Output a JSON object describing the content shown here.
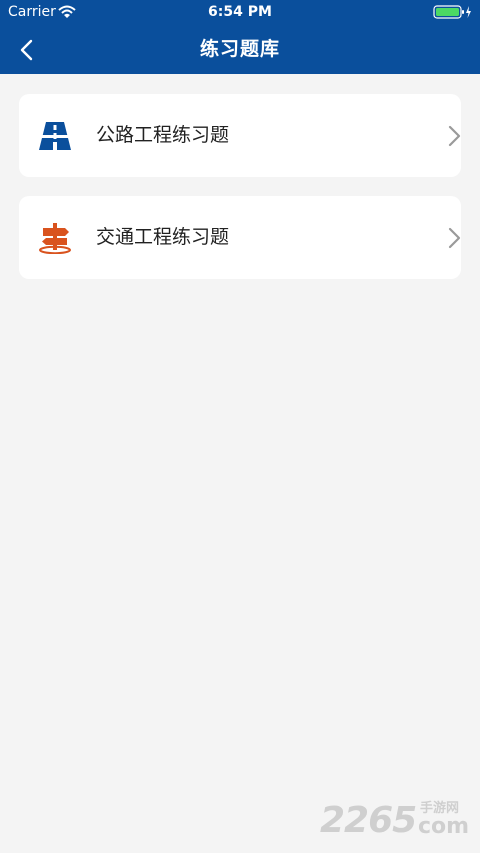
{
  "status_bar": {
    "carrier": "Carrier",
    "time": "6:54 PM"
  },
  "nav": {
    "title": "练习题库"
  },
  "items": [
    {
      "label": "公路工程练习题",
      "icon": "highway-icon"
    },
    {
      "label": "交通工程练习题",
      "icon": "signpost-icon"
    }
  ],
  "watermark": {
    "number": "2265",
    "text": "手游网",
    "suffix": "com"
  },
  "colors": {
    "header": "#0a4f9c",
    "background": "#f4f4f4",
    "card": "#ffffff",
    "highway_icon": "#0a4f9c",
    "signpost_icon": "#d9531e",
    "chevron": "#9a9a9a"
  }
}
